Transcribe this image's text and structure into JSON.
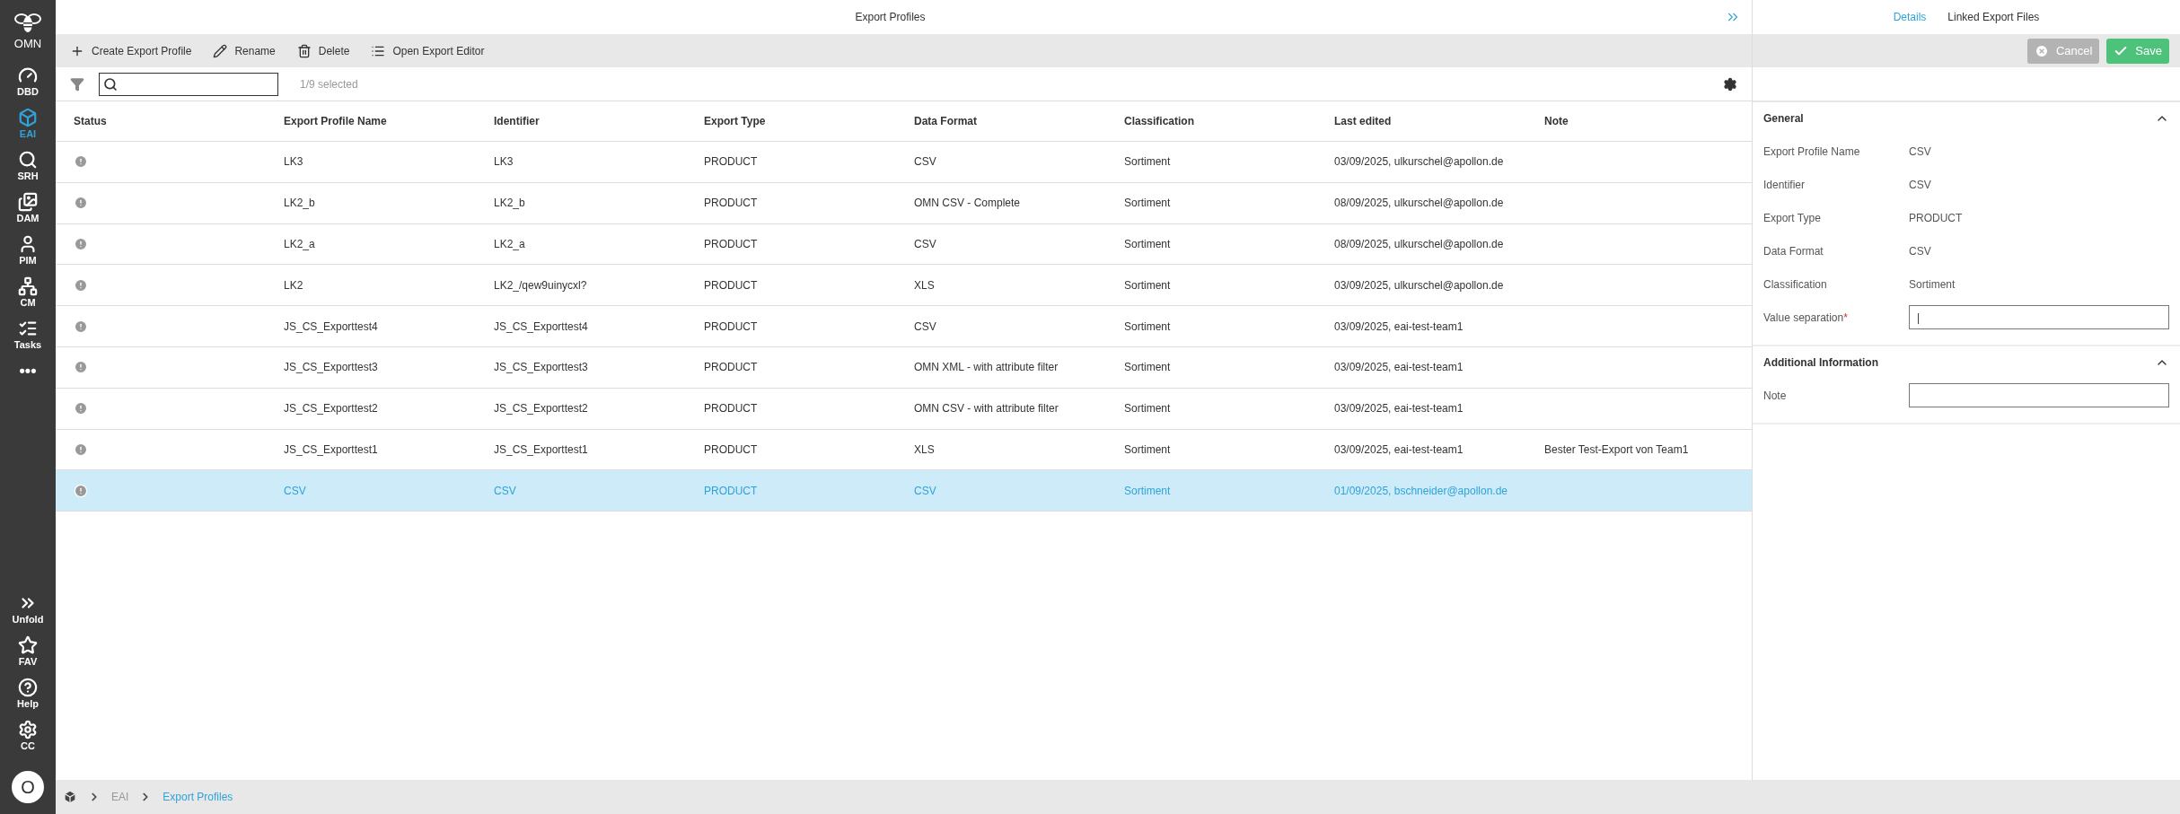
{
  "sidebar": {
    "logo": "OMN",
    "items": [
      {
        "kind": "gauge",
        "label": "DBD",
        "selected": false
      },
      {
        "kind": "cube",
        "label": "EAI",
        "selected": true
      },
      {
        "kind": "search",
        "label": "SRH",
        "selected": false
      },
      {
        "kind": "images",
        "label": "DAM",
        "selected": false
      },
      {
        "kind": "person",
        "label": "PIM",
        "selected": false
      },
      {
        "kind": "network",
        "label": "CM",
        "selected": false
      },
      {
        "kind": "tasks",
        "label": "Tasks",
        "selected": false
      },
      {
        "kind": "more",
        "label": "•••",
        "selected": false
      }
    ],
    "bottom_items": [
      {
        "kind": "unfold",
        "label": "Unfold"
      },
      {
        "kind": "star",
        "label": "FAV"
      },
      {
        "kind": "help",
        "label": "Help"
      },
      {
        "kind": "gear",
        "label": "CC"
      }
    ],
    "avatar": "O"
  },
  "header": {
    "title": "Export Profiles"
  },
  "toolbar": [
    {
      "kind": "plus",
      "label": "Create Export Profile"
    },
    {
      "kind": "pencil",
      "label": "Rename"
    },
    {
      "kind": "trash",
      "label": "Delete"
    },
    {
      "kind": "list",
      "label": "Open Export Editor"
    }
  ],
  "filter": {
    "selection_count": "1/9 selected"
  },
  "table": {
    "columns": [
      "Status",
      "Export Profile Name",
      "Identifier",
      "Export Type",
      "Data Format",
      "Classification",
      "Last edited",
      "Note"
    ],
    "rows": [
      {
        "selected": false,
        "cells": [
          "",
          "LK3",
          "LK3",
          "PRODUCT",
          "CSV",
          "Sortiment",
          "03/09/2025, ulkurschel@apollon.de"
        ]
      },
      {
        "selected": false,
        "cells": [
          "",
          "LK2_b",
          "LK2_b",
          "PRODUCT",
          "OMN CSV - Complete",
          "Sortiment",
          "08/09/2025, ulkurschel@apollon.de"
        ]
      },
      {
        "selected": false,
        "cells": [
          "",
          "LK2_a",
          "LK2_a",
          "PRODUCT",
          "CSV",
          "Sortiment",
          "08/09/2025, ulkurschel@apollon.de"
        ]
      },
      {
        "selected": false,
        "cells": [
          "",
          "LK2",
          "LK2_/qew9uinycxl?",
          "PRODUCT",
          "XLS",
          "Sortiment",
          "03/09/2025, ulkurschel@apollon.de"
        ]
      },
      {
        "selected": false,
        "cells": [
          "",
          "JS_CS_Exporttest4",
          "JS_CS_Exporttest4",
          "PRODUCT",
          "CSV",
          "Sortiment",
          "03/09/2025, eai-test-team1"
        ]
      },
      {
        "selected": false,
        "cells": [
          "",
          "JS_CS_Exporttest3",
          "JS_CS_Exporttest3",
          "PRODUCT",
          "OMN XML - with attribute filter",
          "Sortiment",
          "03/09/2025, eai-test-team1"
        ]
      },
      {
        "selected": false,
        "cells": [
          "",
          "JS_CS_Exporttest2",
          "JS_CS_Exporttest2",
          "PRODUCT",
          "OMN CSV - with attribute filter",
          "Sortiment",
          "03/09/2025, eai-test-team1"
        ]
      },
      {
        "selected": false,
        "cells": [
          "",
          "JS_CS_Exporttest1",
          "JS_CS_Exporttest1",
          "PRODUCT",
          "XLS",
          "Sortiment",
          "03/09/2025, eai-test-team1",
          "Bester Test-Export von Team1"
        ]
      },
      {
        "selected": true,
        "cells": [
          "",
          "CSV",
          "CSV",
          "PRODUCT",
          "CSV",
          "Sortiment",
          "01/09/2025, bschneider@apollon.de"
        ]
      }
    ]
  },
  "breadcrumb": [
    {
      "label": "EAI",
      "selected": false
    },
    {
      "label": "Export Profiles",
      "selected": true
    }
  ],
  "details": {
    "tabs": [
      {
        "label": "Details",
        "selected": true
      },
      {
        "label": "Linked Export Files",
        "selected": false
      }
    ],
    "buttons": [
      {
        "kind": "cancel",
        "label": "Cancel",
        "disabled": true
      },
      {
        "kind": "save",
        "label": "Save",
        "disabled": false
      }
    ],
    "sections": [
      {
        "title": "General",
        "expanded": true,
        "fields": [
          {
            "kind": "text",
            "label": "Export Profile Name",
            "value": "CSV"
          },
          {
            "kind": "text",
            "label": "Identifier",
            "value": "CSV"
          },
          {
            "kind": "text",
            "label": "Export Type",
            "value": "PRODUCT"
          },
          {
            "kind": "text",
            "label": "Data Format",
            "value": "CSV"
          },
          {
            "kind": "text",
            "label": "Classification",
            "value": "Sortiment"
          },
          {
            "kind": "input",
            "label": "Value separation",
            "required_mark": "*",
            "value": "|"
          }
        ]
      },
      {
        "title": "Additional Information",
        "expanded": true,
        "fields": [
          {
            "kind": "input",
            "label": "Note"
          }
        ]
      }
    ]
  }
}
